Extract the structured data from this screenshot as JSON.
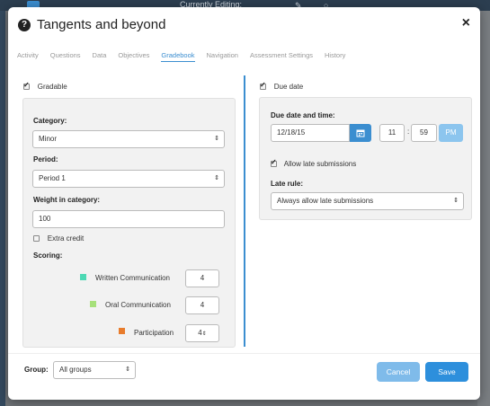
{
  "background": {
    "top_title": "Currently Editing:"
  },
  "modal": {
    "title": "Tangents and beyond",
    "close_label": "×",
    "help_label": "?"
  },
  "tabs": [
    {
      "label": "Activity"
    },
    {
      "label": "Questions"
    },
    {
      "label": "Data"
    },
    {
      "label": "Objectives"
    },
    {
      "label": "Gradebook",
      "active": true
    },
    {
      "label": "Navigation"
    },
    {
      "label": "Assessment Settings"
    },
    {
      "label": "History"
    }
  ],
  "gradebook": {
    "gradable_label": "Gradable",
    "gradable_checked": true,
    "category": {
      "label": "Category:",
      "value": "Minor"
    },
    "period": {
      "label": "Period:",
      "value": "Period 1"
    },
    "weight": {
      "label": "Weight in category:",
      "value": "100"
    },
    "extra_credit": {
      "label": "Extra credit",
      "checked": false
    },
    "scoring": {
      "label": "Scoring:",
      "items": [
        {
          "name": "Written Communication",
          "value": "4",
          "color": "#4dd9b4"
        },
        {
          "name": "Oral Communication",
          "value": "4",
          "color": "#a6e07a"
        },
        {
          "name": "Participation",
          "value": "4",
          "color": "#e87c2c"
        }
      ]
    }
  },
  "due": {
    "due_date_label": "Due date",
    "due_date_checked": true,
    "date_time_label": "Due date and time:",
    "date_value": "12/18/15",
    "hour": "11",
    "minute": "59",
    "time_sep": ":",
    "ampm": "PM",
    "allow_late": {
      "label": "Allow late submissions",
      "checked": true
    },
    "late_rule": {
      "label": "Late rule:",
      "value": "Always allow late submissions"
    }
  },
  "footer": {
    "group_label": "Group:",
    "group_value": "All groups",
    "cancel_label": "Cancel",
    "save_label": "Save"
  },
  "colors": {
    "accent": "#3b8ed0",
    "cancel_bg": "#7fbbea",
    "save_bg": "#2d8fdc"
  }
}
